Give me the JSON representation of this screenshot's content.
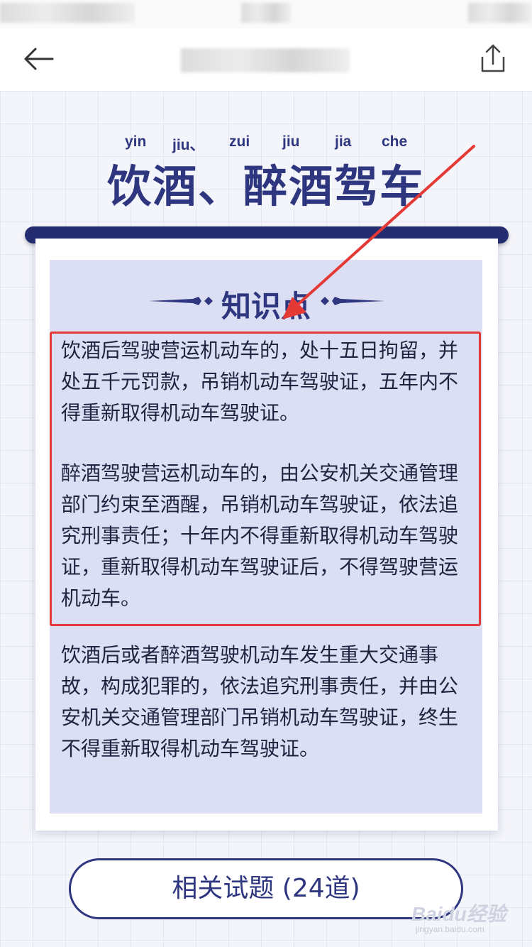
{
  "header": {
    "back_icon": "back-arrow-icon",
    "share_icon": "share-icon"
  },
  "hero": {
    "pinyin": [
      "yin",
      "jiu、",
      "zui",
      "jiu",
      "jia",
      "che"
    ],
    "title": "饮酒、醉酒驾车"
  },
  "card": {
    "section_title": "知识点",
    "paragraphs": [
      "饮酒后驾驶营运机动车的，处十五日拘留，并处五千元罚款，吊销机动车驾驶证，五年内不得重新取得机动车驾驶证。",
      "醉酒驾驶营运机动车的，由公安机关交通管理部门约束至酒醒，吊销机动车驾驶证，依法追究刑事责任；十年内不得重新取得机动车驾驶证，重新取得机动车驾驶证后，不得驾驶营运机动车。",
      "饮酒后或者醉酒驾驶机动车发生重大交通事故，构成犯罪的，依法追究刑事责任，并由公安机关交通管理部门吊销机动车驾驶证，终生不得重新取得机动车驾驶证。"
    ]
  },
  "footer": {
    "related_button": "相关试题 (24道)"
  },
  "watermark": {
    "brand": "Baidu经验",
    "url": "jingyan.baidu.com"
  },
  "colors": {
    "primary": "#2e3680",
    "panel": "#dcdff4",
    "highlight": "#e53935"
  }
}
